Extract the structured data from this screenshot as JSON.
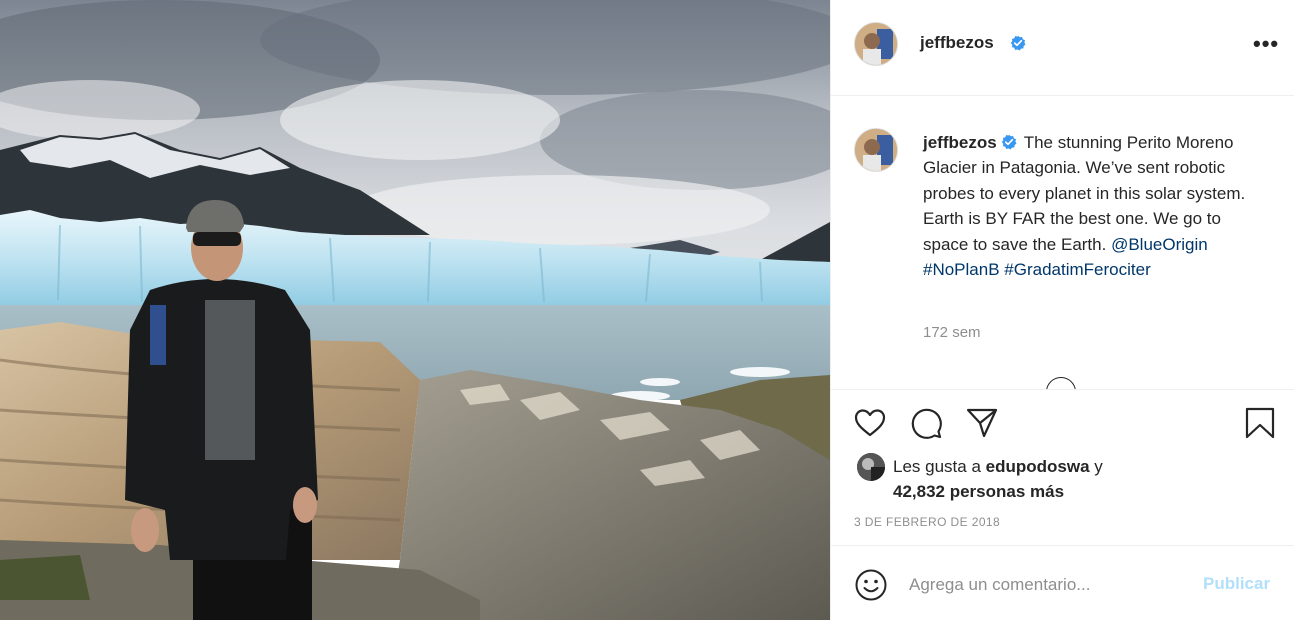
{
  "post": {
    "username": "jeffbezos",
    "verified": true,
    "caption_text": "The stunning Perito Moreno Glacier in Patagonia. We’ve sent robotic probes to every planet in this solar system. Earth is BY FAR the best one. We go to space to save the Earth.",
    "mention": "@BlueOrigin",
    "hashtags": [
      "#NoPlanB",
      "#GradatimFerociter"
    ],
    "time_ago": "172 sem",
    "more_label": "•••"
  },
  "likes": {
    "prefix": "Les gusta a",
    "user": "edupodoswa",
    "joiner": "y",
    "others": "42,832 personas más"
  },
  "date": "3 DE FEBRERO DE 2018",
  "comment": {
    "placeholder": "Agrega un comentario...",
    "publish_label": "Publicar"
  },
  "icons": {
    "header_avatar": "profile-avatar",
    "verified": "verified-badge-icon",
    "like": "heart-icon",
    "comment": "comment-bubble-icon",
    "share": "paper-plane-icon",
    "save": "bookmark-icon",
    "emoji": "smiley-icon"
  },
  "colors": {
    "verified_blue": "#3897f0",
    "link": "#00376b",
    "muted": "#8e8e8e",
    "publish_disabled": "#b2dffc"
  }
}
